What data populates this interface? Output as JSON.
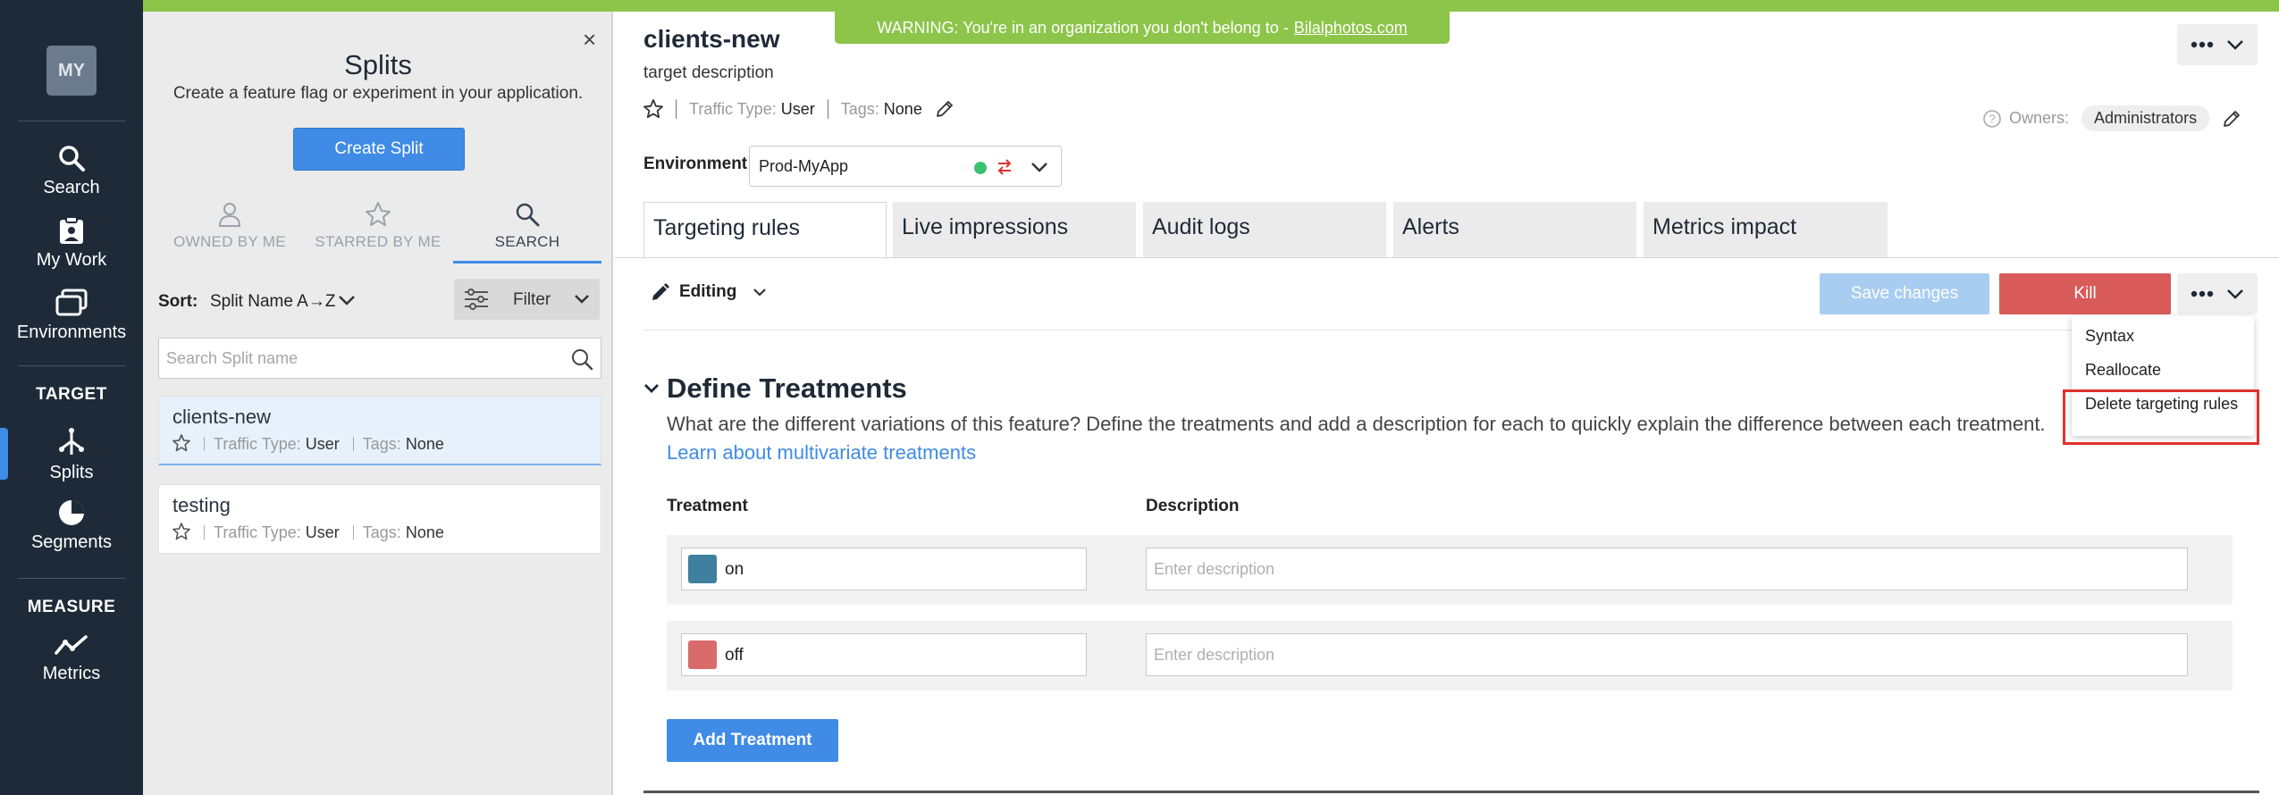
{
  "nav": {
    "avatar": "MY",
    "items": {
      "search": "Search",
      "mywork": "My Work",
      "environments": "Environments",
      "splits": "Splits",
      "segments": "Segments",
      "metrics": "Metrics"
    },
    "headers": {
      "target": "TARGET",
      "measure": "MEASURE"
    },
    "active_item": "Splits"
  },
  "panel": {
    "title": "Splits",
    "subtitle": "Create a feature flag or experiment in your application.",
    "close_label": "×",
    "create_button": "Create Split",
    "tabs": [
      {
        "label": "OWNED BY ME",
        "icon": "person-icon"
      },
      {
        "label": "STARRED BY ME",
        "icon": "star-icon"
      },
      {
        "label": "SEARCH",
        "icon": "search-icon"
      }
    ],
    "active_tab": "SEARCH",
    "sort_label": "Sort:",
    "sort_value": "Split Name A→Z",
    "filter_label": "Filter",
    "search_placeholder": "Search Split name",
    "splits": [
      {
        "name": "clients-new",
        "traffic_type_label": "Traffic Type:",
        "traffic_type": "User",
        "tags_label": "Tags:",
        "tags": "None",
        "selected": true
      },
      {
        "name": "testing",
        "traffic_type_label": "Traffic Type:",
        "traffic_type": "User",
        "tags_label": "Tags:",
        "tags": "None",
        "selected": false
      }
    ]
  },
  "main": {
    "warning_text": "WARNING: You're in an organization you don't belong to -",
    "warning_link": "Bilalphotos.com",
    "split_name": "clients-new",
    "description": "target description",
    "traffic_type_label": "Traffic Type:",
    "traffic_type": "User",
    "tags_label": "Tags:",
    "tags": "None",
    "owners_label": "Owners:",
    "owners_value": "Administrators",
    "environment_label": "Environment",
    "environment_value": "Prod-MyApp",
    "tabs": [
      "Targeting rules",
      "Live impressions",
      "Audit logs",
      "Alerts",
      "Metrics impact"
    ],
    "active_tab": "Targeting rules",
    "editing_label": "Editing",
    "save_button": "Save changes",
    "kill_button": "Kill",
    "menu": [
      "Syntax",
      "Reallocate",
      "Delete targeting rules"
    ],
    "section_title": "Define Treatments",
    "section_desc": "What are the different variations of this feature? Define the treatments and add a description for each to quickly explain the difference between each treatment.",
    "section_link": "Learn about multivariate treatments",
    "col_treatment": "Treatment",
    "col_description": "Description",
    "treatments": [
      {
        "name": "on",
        "color": "#3f7f9f",
        "desc_placeholder": "Enter description"
      },
      {
        "name": "off",
        "color": "#d96b6b",
        "desc_placeholder": "Enter description"
      }
    ],
    "add_button": "Add Treatment"
  },
  "colors": {
    "accent": "#3f8be6",
    "kill": "#d85a59",
    "nav_bg": "#1e2a38",
    "warning_bg": "#8cc54a",
    "env_status": "#3cc16f",
    "highlight": "#e0322b"
  }
}
